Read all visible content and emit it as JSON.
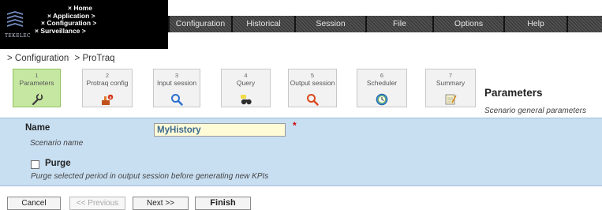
{
  "header": {
    "logo_text": "TEKELEC",
    "nav_crumbs": [
      "× Home",
      "× Application >",
      "× Configuration >",
      "× Surveillance >"
    ],
    "menu": [
      "Configuration",
      "Historical",
      "Session",
      "File",
      "Options",
      "Help"
    ]
  },
  "breadcrumb": [
    "> Configuration",
    "> ProTraq"
  ],
  "wizard": {
    "steps": [
      {
        "num": "1",
        "label": "Parameters",
        "icon": "wrench-icon",
        "active": true
      },
      {
        "num": "2",
        "label": "Protraq config",
        "icon": "config-icon",
        "active": false
      },
      {
        "num": "3",
        "label": "Input session",
        "icon": "magnifier-blue-icon",
        "active": false
      },
      {
        "num": "4",
        "label": "Query",
        "icon": "binoculars-icon",
        "active": false
      },
      {
        "num": "5",
        "label": "Output session",
        "icon": "magnifier-orange-icon",
        "active": false
      },
      {
        "num": "6",
        "label": "Scheduler",
        "icon": "clock-icon",
        "active": false
      },
      {
        "num": "7",
        "label": "Summary",
        "icon": "notepad-icon",
        "active": false
      }
    ],
    "title": "Parameters",
    "subtitle": "Scenario general parameters"
  },
  "form": {
    "name_label": "Name",
    "name_value": "MyHistory",
    "name_desc": "Scenario name",
    "required_mark": "*",
    "purge_label": "Purge",
    "purge_checked": false,
    "purge_desc": "Purge selected period in output session before generating new KPIs"
  },
  "buttons": {
    "cancel": "Cancel",
    "previous": "<< Previous",
    "next": "Next >>",
    "finish": "Finish"
  },
  "colors": {
    "active_step": "#c6e7a2",
    "form_background": "#c8dff2",
    "input_background": "#fffbd7",
    "required": "#d00000"
  }
}
